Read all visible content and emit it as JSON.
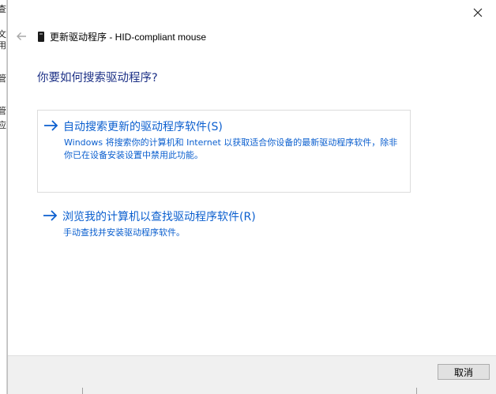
{
  "background_window": {
    "glyphs": [
      "查",
      "文",
      "用",
      "管",
      "管",
      "应"
    ]
  },
  "dialog": {
    "title": "更新驱动程序 - HID-compliant mouse",
    "heading": "你要如何搜索驱动程序?",
    "options": [
      {
        "title": "自动搜索更新的驱动程序软件(S)",
        "description": "Windows 将搜索你的计算机和 Internet 以获取适合你设备的最新驱动程序软件，除非你已在设备安装设置中禁用此功能。"
      },
      {
        "title": "浏览我的计算机以查找驱动程序软件(R)",
        "description": "手动查找并安装驱动程序软件。"
      }
    ],
    "cancel_label": "取消"
  },
  "colors": {
    "heading": "#1e3287",
    "link": "#0b5fcf",
    "footer_bg": "#f0f0f0"
  },
  "icons": {
    "close": "close-icon",
    "back": "back-arrow-icon",
    "device": "mouse-device-icon",
    "option_arrow": "right-arrow-icon"
  }
}
